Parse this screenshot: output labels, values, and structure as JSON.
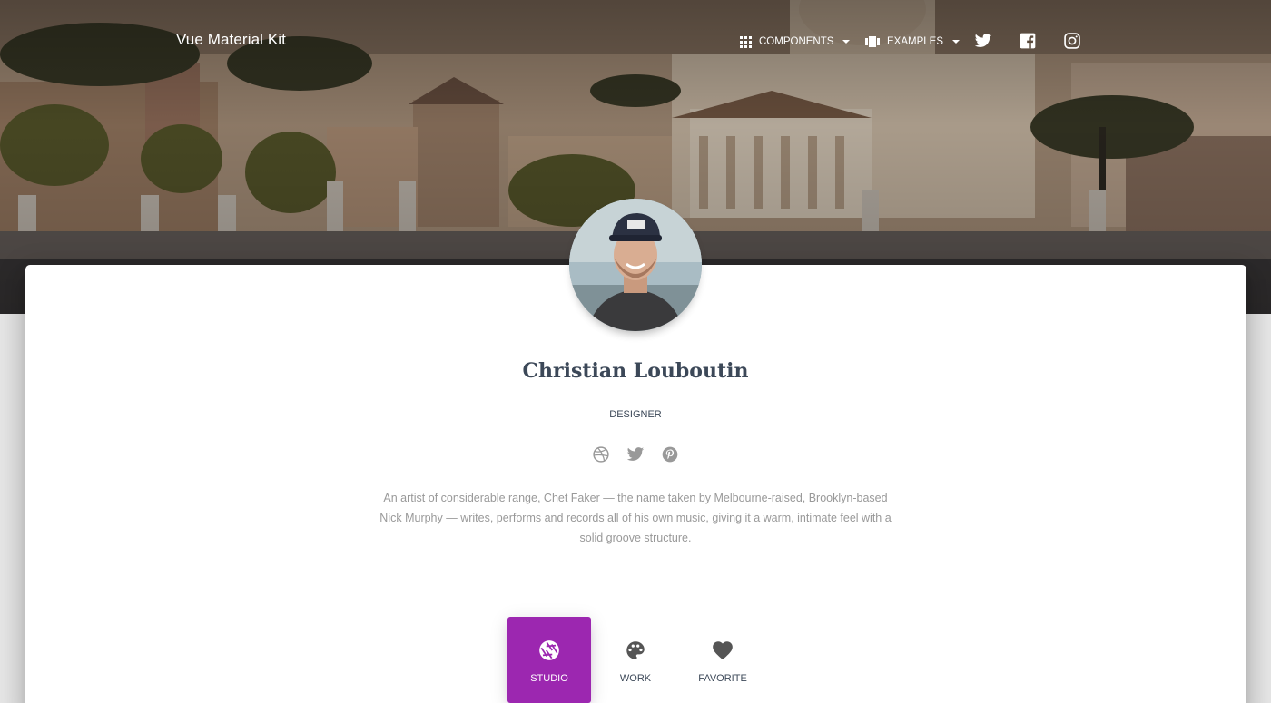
{
  "navbar": {
    "brand": "Vue Material Kit",
    "components_label": "Components",
    "examples_label": "Examples",
    "social_icons": [
      "twitter-icon",
      "facebook-icon",
      "instagram-icon"
    ]
  },
  "profile": {
    "name": "Christian Louboutin",
    "role": "Designer",
    "social_icons": [
      "dribbble-icon",
      "twitter-icon",
      "pinterest-icon"
    ],
    "bio": "An artist of considerable range, Chet Faker — the name taken by Melbourne-raised, Brooklyn-based Nick Murphy — writes, performs and records all of his own music, giving it a warm, intimate feel with a solid groove structure."
  },
  "tabs": [
    {
      "label": "Studio",
      "icon": "camera-aperture-icon",
      "active": true
    },
    {
      "label": "Work",
      "icon": "palette-icon",
      "active": false
    },
    {
      "label": "Favorite",
      "icon": "heart-icon",
      "active": false
    }
  ],
  "colors": {
    "accent": "#9c27b0",
    "title": "#3c4858",
    "muted": "#999999"
  }
}
